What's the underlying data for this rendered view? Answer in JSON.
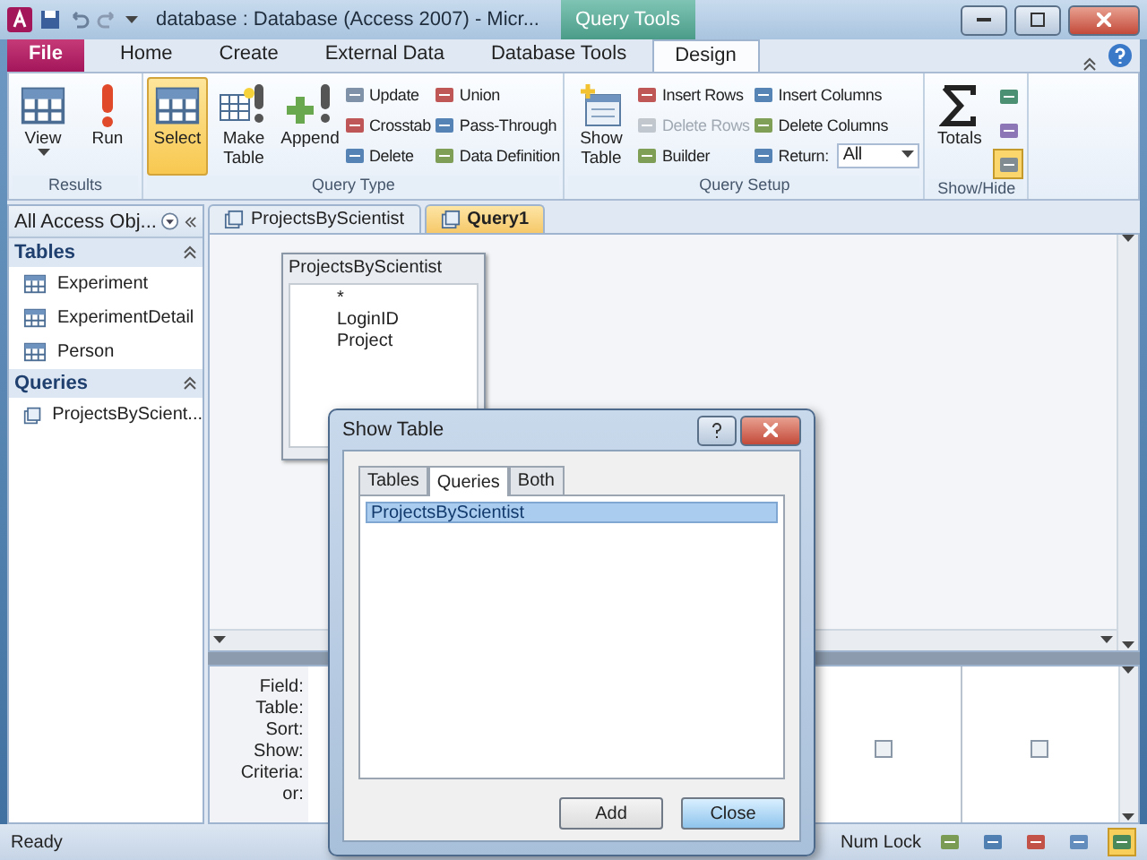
{
  "window": {
    "title": "database : Database (Access 2007) - Micr...",
    "context_tab": "Query Tools"
  },
  "ribbon_tabs": [
    {
      "label": "File",
      "kind": "file",
      "selected": false
    },
    {
      "label": "Home",
      "kind": "tab",
      "selected": false
    },
    {
      "label": "Create",
      "kind": "tab",
      "selected": false
    },
    {
      "label": "External Data",
      "kind": "tab",
      "selected": false
    },
    {
      "label": "Database Tools",
      "kind": "tab",
      "selected": false
    },
    {
      "label": "Design",
      "kind": "tab",
      "selected": true
    }
  ],
  "ribbon_groups": [
    {
      "label": "Results",
      "items": [
        {
          "kind": "large",
          "label": "View",
          "dropdown": true,
          "selected": false
        },
        {
          "kind": "large",
          "label": "Run",
          "selected": false
        }
      ]
    },
    {
      "label": "Query Type",
      "items": [
        {
          "kind": "large",
          "label": "Select",
          "selected": true
        },
        {
          "kind": "large",
          "label": "Make Table",
          "selected": false
        },
        {
          "kind": "large",
          "label": "Append",
          "selected": false
        },
        {
          "kind": "stack",
          "entries": [
            {
              "label": "Update",
              "disabled": false
            },
            {
              "label": "Crosstab",
              "disabled": false
            },
            {
              "label": "Delete",
              "disabled": false
            }
          ]
        },
        {
          "kind": "stack",
          "entries": [
            {
              "label": "Union",
              "disabled": false
            },
            {
              "label": "Pass-Through",
              "disabled": false
            },
            {
              "label": "Data Definition",
              "disabled": false
            }
          ]
        }
      ]
    },
    {
      "label": "Query Setup",
      "items": [
        {
          "kind": "large",
          "label": "Show Table",
          "selected": false
        },
        {
          "kind": "stack",
          "entries": [
            {
              "label": "Insert Rows",
              "disabled": false
            },
            {
              "label": "Delete Rows",
              "disabled": true
            },
            {
              "label": "Builder",
              "disabled": false
            }
          ]
        },
        {
          "kind": "stack",
          "entries": [
            {
              "label": "Insert Columns",
              "disabled": false
            },
            {
              "label": "Delete Columns",
              "disabled": false
            },
            {
              "label": "Return:",
              "disabled": false,
              "value": "All"
            }
          ]
        }
      ]
    },
    {
      "label": "Show/Hide",
      "items": [
        {
          "kind": "large",
          "label": "Totals",
          "selected": false
        },
        {
          "kind": "toggles",
          "toggles": [
            {
              "selected": false
            },
            {
              "selected": false
            },
            {
              "selected": true
            }
          ]
        }
      ]
    }
  ],
  "nav_pane": {
    "title": "All Access Obj...",
    "sections": [
      {
        "label": "Tables",
        "expanded": true,
        "items": [
          "Experiment",
          "ExperimentDetail",
          "Person"
        ]
      },
      {
        "label": "Queries",
        "expanded": true,
        "items": [
          "ProjectsByScient..."
        ]
      }
    ]
  },
  "doc_tabs": [
    {
      "label": "ProjectsByScientist",
      "selected": false
    },
    {
      "label": "Query1",
      "selected": true
    }
  ],
  "table_box": {
    "title": "ProjectsByScientist",
    "fields": [
      "*",
      "LoginID",
      "Project"
    ]
  },
  "grid": {
    "row_labels": [
      "Field:",
      "Table:",
      "Sort:",
      "Show:",
      "Criteria:",
      "or:"
    ],
    "columns": [
      {
        "show": false
      },
      {
        "show": false
      }
    ]
  },
  "dialog": {
    "title": "Show Table",
    "tabs": [
      {
        "label": "Tables",
        "selected": false
      },
      {
        "label": "Queries",
        "selected": true
      },
      {
        "label": "Both",
        "selected": false
      }
    ],
    "items": [
      {
        "label": "ProjectsByScientist",
        "selected": true
      }
    ],
    "buttons": [
      {
        "label": "Add",
        "focused": false
      },
      {
        "label": "Close",
        "focused": true
      }
    ]
  },
  "status_bar": {
    "text": "Ready",
    "num_lock": "Num Lock",
    "views": [
      {
        "selected": false
      },
      {
        "selected": false
      },
      {
        "selected": false
      },
      {
        "selected": false
      },
      {
        "selected": true
      }
    ]
  }
}
